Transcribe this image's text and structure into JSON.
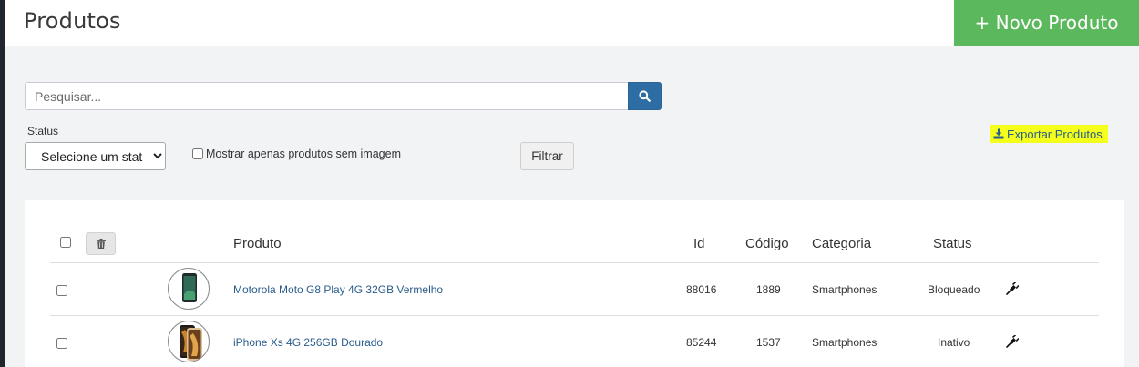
{
  "header": {
    "title": "Produtos",
    "new_product_label": "+ Novo Produto"
  },
  "search": {
    "placeholder": "Pesquisar...",
    "value": ""
  },
  "filters": {
    "status_label": "Status",
    "status_selected": "Selecione um status",
    "only_without_image_label": "Mostrar apenas produtos sem imagem",
    "filter_button": "Filtrar"
  },
  "export_label": "Exportar Produtos",
  "table": {
    "columns": [
      "Produto",
      "Id",
      "Código",
      "Categoria",
      "Status"
    ],
    "rows": [
      {
        "produto": "Motorola Moto G8 Play 4G 32GB Vermelho",
        "id": "88016",
        "codigo": "1889",
        "categoria": "Smartphones",
        "status": "Bloqueado"
      },
      {
        "produto": "iPhone Xs 4G 256GB Dourado",
        "id": "85244",
        "codigo": "1537",
        "categoria": "Smartphones",
        "status": "Inativo"
      }
    ]
  },
  "icons": {
    "search": "search-icon",
    "download": "download-icon",
    "trash": "trash-icon",
    "plug": "plug-icon"
  },
  "colors": {
    "primary": "#2e6da4",
    "success": "#5cb85c",
    "highlight": "#f4ff1c",
    "link": "#2b5d8c"
  }
}
